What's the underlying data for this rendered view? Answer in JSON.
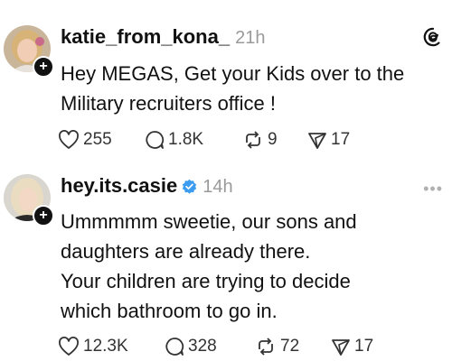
{
  "posts": [
    {
      "username": "katie_from_kona_",
      "time": "21h",
      "verified": false,
      "lines": [
        "Hey MEGAS, Get your Kids over to the",
        "Military recruiters office !"
      ],
      "actions": {
        "likes": "255",
        "replies": "1.8K",
        "reposts": "9",
        "shares": "17"
      },
      "top_icon": "threads-logo-icon"
    },
    {
      "username": "hey.its.casie",
      "time": "14h",
      "verified": true,
      "lines": [
        "Ummmmm sweetie, our sons and",
        "daughters are already there.",
        "Your children are trying to decide",
        "which bathroom to go in."
      ],
      "actions": {
        "likes": "12.3K",
        "replies": "328",
        "reposts": "72",
        "shares": "17"
      },
      "top_icon": "more-options-icon"
    }
  ],
  "colors": {
    "text": "#111111",
    "muted": "#9a9a9a",
    "verified": "#3b9cf0"
  }
}
